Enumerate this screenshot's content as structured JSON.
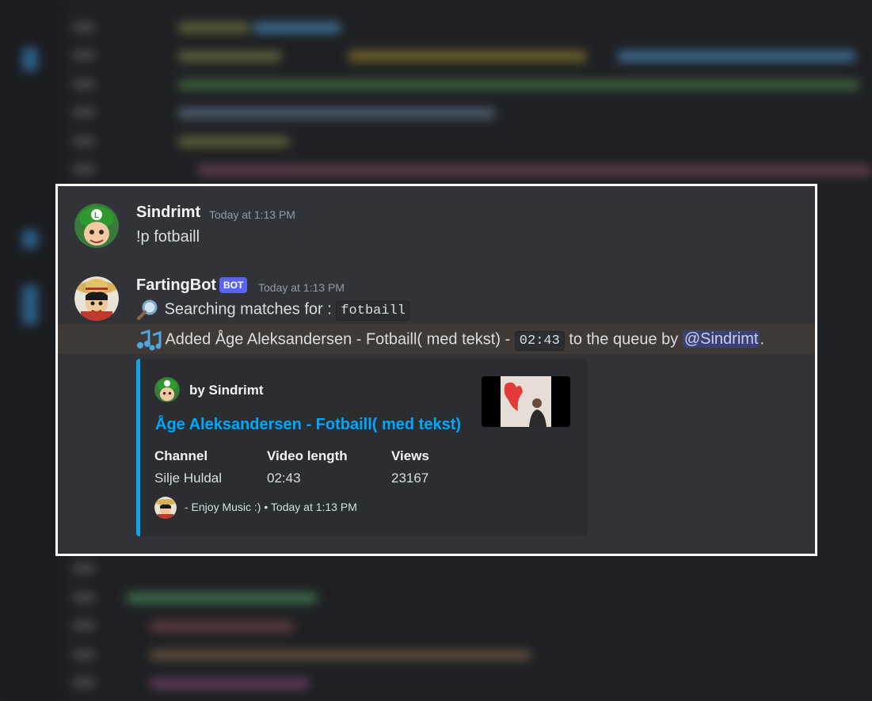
{
  "messages": [
    {
      "username": "Sindrimt",
      "timestamp": "Today at 1:13 PM",
      "text": "!p fotbaill"
    },
    {
      "username": "FartingBot",
      "badge": "BOT",
      "timestamp": "Today at 1:13 PM",
      "search_prefix": "Searching matches for :",
      "search_query": "fotbaill",
      "added_prefix": "Added Åge Aleksandersen - Fotbaill( med tekst) -",
      "added_duration": "02:43",
      "added_suffix": "to the queue by",
      "added_mention": "@Sindrimt",
      "added_period": "."
    }
  ],
  "embed": {
    "author": "by  Sindrimt",
    "title": "Åge Aleksandersen - Fotbaill( med tekst)",
    "fields": [
      {
        "name": "Channel",
        "value": "Silje Huldal"
      },
      {
        "name": "Video length",
        "value": "02:43"
      },
      {
        "name": "Views",
        "value": "23167"
      }
    ],
    "footer_text": "- Enjoy Music :)",
    "footer_time": "Today at 1:13 PM",
    "footer_separator": "•",
    "accent_color": "#0ea5e9"
  },
  "icons": {
    "search": "magnifying-glass-icon",
    "music": "music-notes-icon"
  },
  "colors": {
    "panel_bg": "#313338",
    "highlight_bg": "#3f3a36",
    "badge_bg": "#5865f2",
    "link": "#00a8fc"
  }
}
